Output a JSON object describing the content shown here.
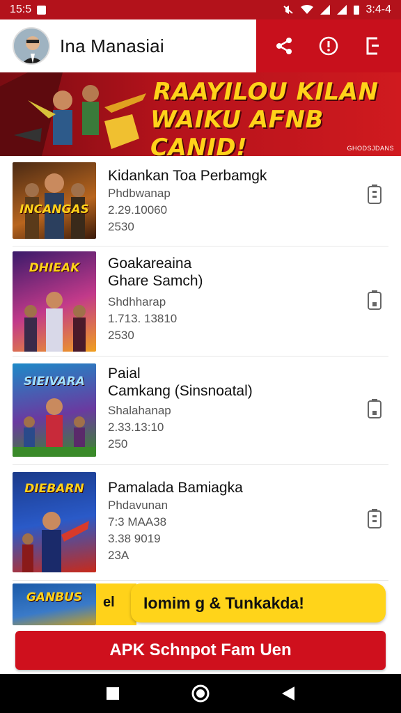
{
  "status_bar": {
    "time": "15:5",
    "battery_time": "3:4-4"
  },
  "header": {
    "title": "Ina Manasiai"
  },
  "banner": {
    "line1": "RAAYILOU KILAN",
    "line2": "WAIKU AFNB CANID!",
    "footer": "GHODSJDANS"
  },
  "items": [
    {
      "thumb_text": "INCANGAS",
      "title": "Kidankan Toa Perbamgk",
      "meta1": "Phdbwanap",
      "meta2": "2.29.10060",
      "meta3": "2530"
    },
    {
      "thumb_text": "DHIEAK",
      "title": "Goakareaina\nGhare Samch)",
      "meta1": "Shdhharap",
      "meta2": "1.713. 13810",
      "meta3": "2530"
    },
    {
      "thumb_text": "SIEIVARA",
      "title": "Paial\nCamkang (Sinsnoatal)",
      "meta1": "Shalahanap",
      "meta2": "2.33.13:10",
      "meta3": "250"
    },
    {
      "thumb_text": "DIEBARN",
      "title": "Pamalada Bamiagka",
      "meta1": "Phdavunan",
      "meta2": "7:3 MAA38",
      "meta3": "3.38 9019",
      "meta4": "23A"
    }
  ],
  "partial_item": {
    "thumb_text": "GANBUS",
    "strip_text": "el"
  },
  "tooltip": {
    "text": "Iomim g & Tunkakda!"
  },
  "cta": {
    "label": "APK Schnpot Fam Uen"
  },
  "colors": {
    "brand_red": "#c8101c",
    "accent_yellow": "#ffd21a"
  }
}
